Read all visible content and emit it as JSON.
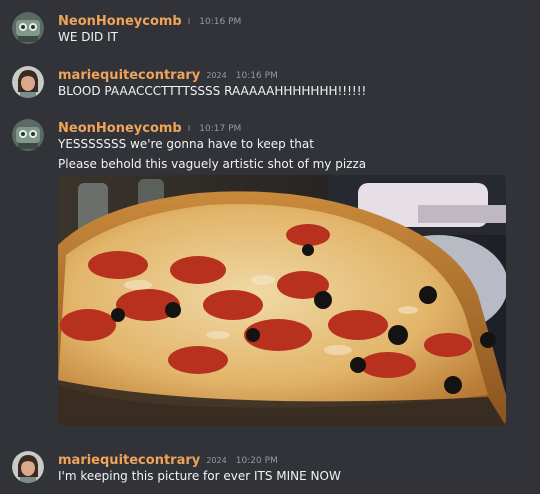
{
  "messages": [
    {
      "author": "NeonHoneycomb",
      "badge": "I",
      "time": "10:16 PM",
      "lines": [
        "WE DID IT"
      ]
    },
    {
      "author": "mariequitecontrary",
      "badge": "2024",
      "time": "10:16 PM",
      "lines": [
        "BLOOD PAAACCCTTTTSSSS RAAAAAHHHHHHH!!!!!!"
      ]
    },
    {
      "author": "NeonHoneycomb",
      "badge": "I",
      "time": "10:17 PM",
      "lines": [
        "YESSSSSSS we're gonna have to keep that",
        "Please behold this vaguely artistic shot of my pizza"
      ],
      "attachment": {
        "type": "image",
        "subject": "pizza-photo"
      }
    },
    {
      "author": "mariequitecontrary",
      "badge": "2024",
      "time": "10:20 PM",
      "lines": [
        "I'm keeping this picture for ever ITS MINE NOW"
      ]
    }
  ],
  "colors": {
    "background": "#313338",
    "username": "#f0a35a",
    "timestamp": "#949ba4",
    "message_text": "#f2f3f5"
  }
}
